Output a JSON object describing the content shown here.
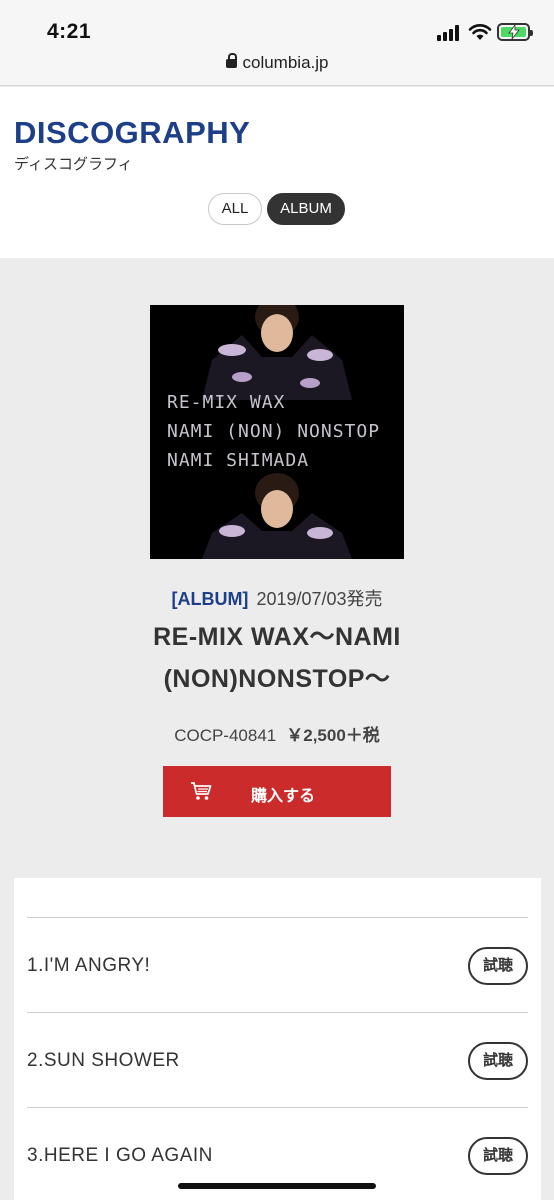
{
  "status_bar": {
    "time": "4:21",
    "url": "columbia.jp"
  },
  "header": {
    "title": "DISCOGRAPHY",
    "subtitle": "ディスコグラフィ",
    "filters": [
      "ALL",
      "ALBUM"
    ],
    "active_filter": "ALBUM"
  },
  "release": {
    "cover_text": [
      "RE-MIX WAX",
      "NAMI (NON) NONSTOP",
      "NAMI SHIMADA"
    ],
    "type": "[ALBUM]",
    "date": "2019/07/03発売",
    "title_lines": [
      "RE-MIX WAX〜NAMI",
      "(NON)NONSTOP〜"
    ],
    "catalog_number": "COCP-40841",
    "price": "￥2,500＋税",
    "buy_label": "購入する"
  },
  "tracks": [
    {
      "title": "1.I'M ANGRY!",
      "listen_label": "試聴"
    },
    {
      "title": "2.SUN SHOWER",
      "listen_label": "試聴"
    },
    {
      "title": "3.HERE I GO AGAIN",
      "listen_label": "試聴"
    }
  ],
  "colors": {
    "brand_blue": "#1d3f8a",
    "buy_red": "#cc2b2b",
    "battery_green": "#4cd964"
  }
}
